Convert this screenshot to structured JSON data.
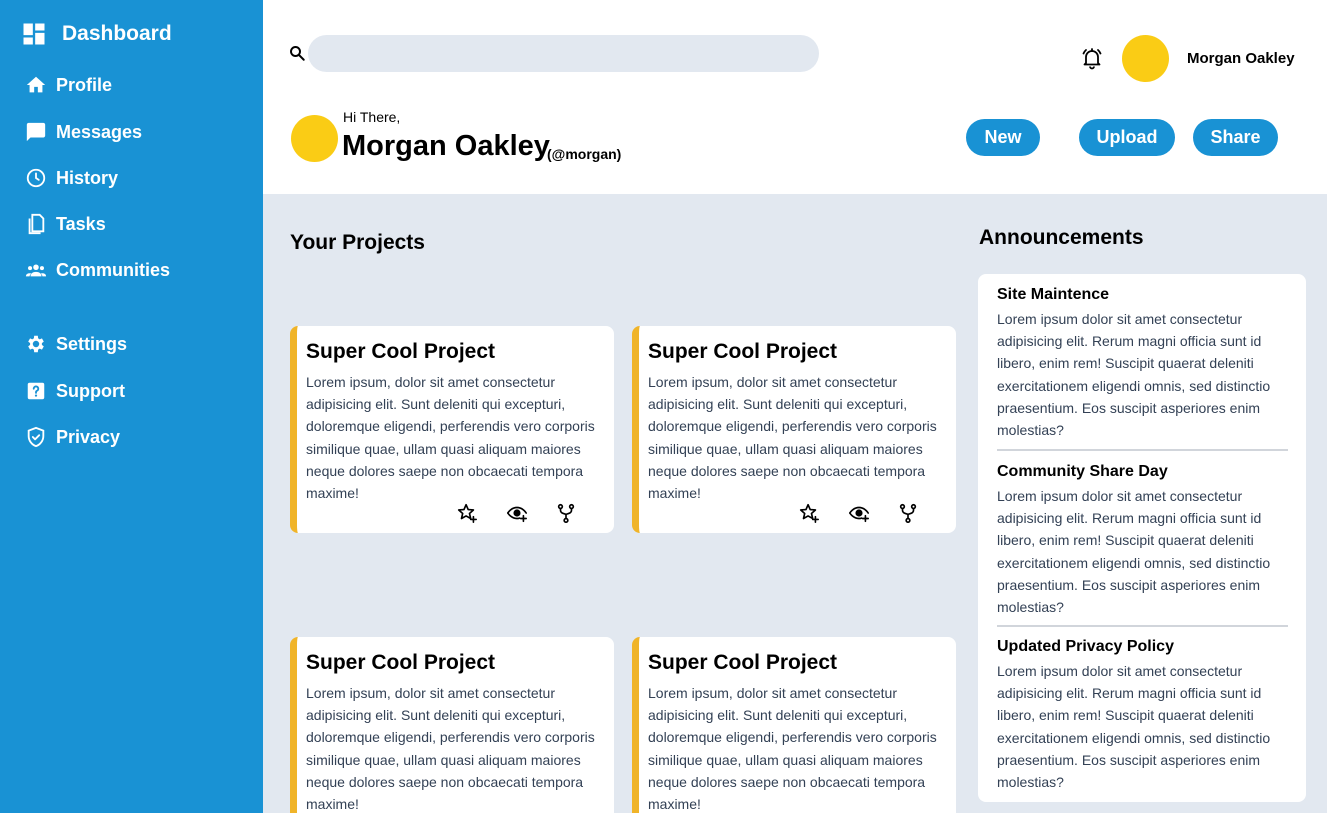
{
  "sidebar": {
    "brand": {
      "title": "Dashboard",
      "icon": "dashboard-icon"
    },
    "items": [
      {
        "label": "Profile",
        "icon": "home-icon"
      },
      {
        "label": "Messages",
        "icon": "message-icon"
      },
      {
        "label": "History",
        "icon": "clock-icon"
      },
      {
        "label": "Tasks",
        "icon": "document-icon"
      },
      {
        "label": "Communities",
        "icon": "people-icon"
      },
      {
        "label": "Settings",
        "icon": "gear-icon"
      },
      {
        "label": "Support",
        "icon": "help-icon"
      },
      {
        "label": "Privacy",
        "icon": "shield-icon"
      }
    ]
  },
  "header": {
    "search": {
      "placeholder": "",
      "value": ""
    },
    "user": {
      "name": "Morgan Oakley"
    },
    "greeting": "Hi There,",
    "profile_name": "Morgan Oakley",
    "handle": "(@morgan)",
    "buttons": {
      "new": "New",
      "upload": "Upload",
      "share": "Share"
    }
  },
  "projects": {
    "title": "Your Projects",
    "cards": [
      {
        "title": "Super Cool Project",
        "description": "Lorem ipsum, dolor sit amet consectetur adipisicing elit. Sunt deleniti qui excepturi, doloremque eligendi, perferendis vero corporis similique quae, ullam quasi aliquam maiores neque dolores saepe non obcaecati tempora maxime!"
      },
      {
        "title": "Super Cool Project",
        "description": "Lorem ipsum, dolor sit amet consectetur adipisicing elit. Sunt deleniti qui excepturi, doloremque eligendi, perferendis vero corporis similique quae, ullam quasi aliquam maiores neque dolores saepe non obcaecati tempora maxime!"
      },
      {
        "title": "Super Cool Project",
        "description": "Lorem ipsum, dolor sit amet consectetur adipisicing elit. Sunt deleniti qui excepturi, doloremque eligendi, perferendis vero corporis similique quae, ullam quasi aliquam maiores neque dolores saepe non obcaecati tempora maxime!"
      },
      {
        "title": "Super Cool Project",
        "description": "Lorem ipsum, dolor sit amet consectetur adipisicing elit. Sunt deleniti qui excepturi, doloremque eligendi, perferendis vero corporis similique quae, ullam quasi aliquam maiores neque dolores saepe non obcaecati tempora maxime!"
      }
    ],
    "card_actions": [
      "star-add-icon",
      "watch-icon",
      "fork-icon"
    ]
  },
  "announcements": {
    "title": "Announcements",
    "items": [
      {
        "title": "Site Maintence",
        "body": "Lorem ipsum dolor sit amet consectetur adipisicing elit. Rerum magni officia sunt id libero, enim rem! Suscipit quaerat deleniti exercitationem eligendi omnis, sed distinctio praesentium. Eos suscipit asperiores enim molestias?"
      },
      {
        "title": "Community Share Day",
        "body": "Lorem ipsum dolor sit amet consectetur adipisicing elit. Rerum magni officia sunt id libero, enim rem! Suscipit quaerat deleniti exercitationem eligendi omnis, sed distinctio praesentium. Eos suscipit asperiores enim molestias?"
      },
      {
        "title": "Updated Privacy Policy",
        "body": "Lorem ipsum dolor sit amet consectetur adipisicing elit. Rerum magni officia sunt id libero, enim rem! Suscipit quaerat deleniti exercitationem eligendi omnis, sed distinctio praesentium. Eos suscipit asperiores enim molestias?"
      }
    ]
  },
  "colors": {
    "sidebar": "#1992d4",
    "accent": "#f0b429",
    "avatar": "#facc15",
    "background": "#e2e8f0",
    "button": "#1992d4"
  }
}
